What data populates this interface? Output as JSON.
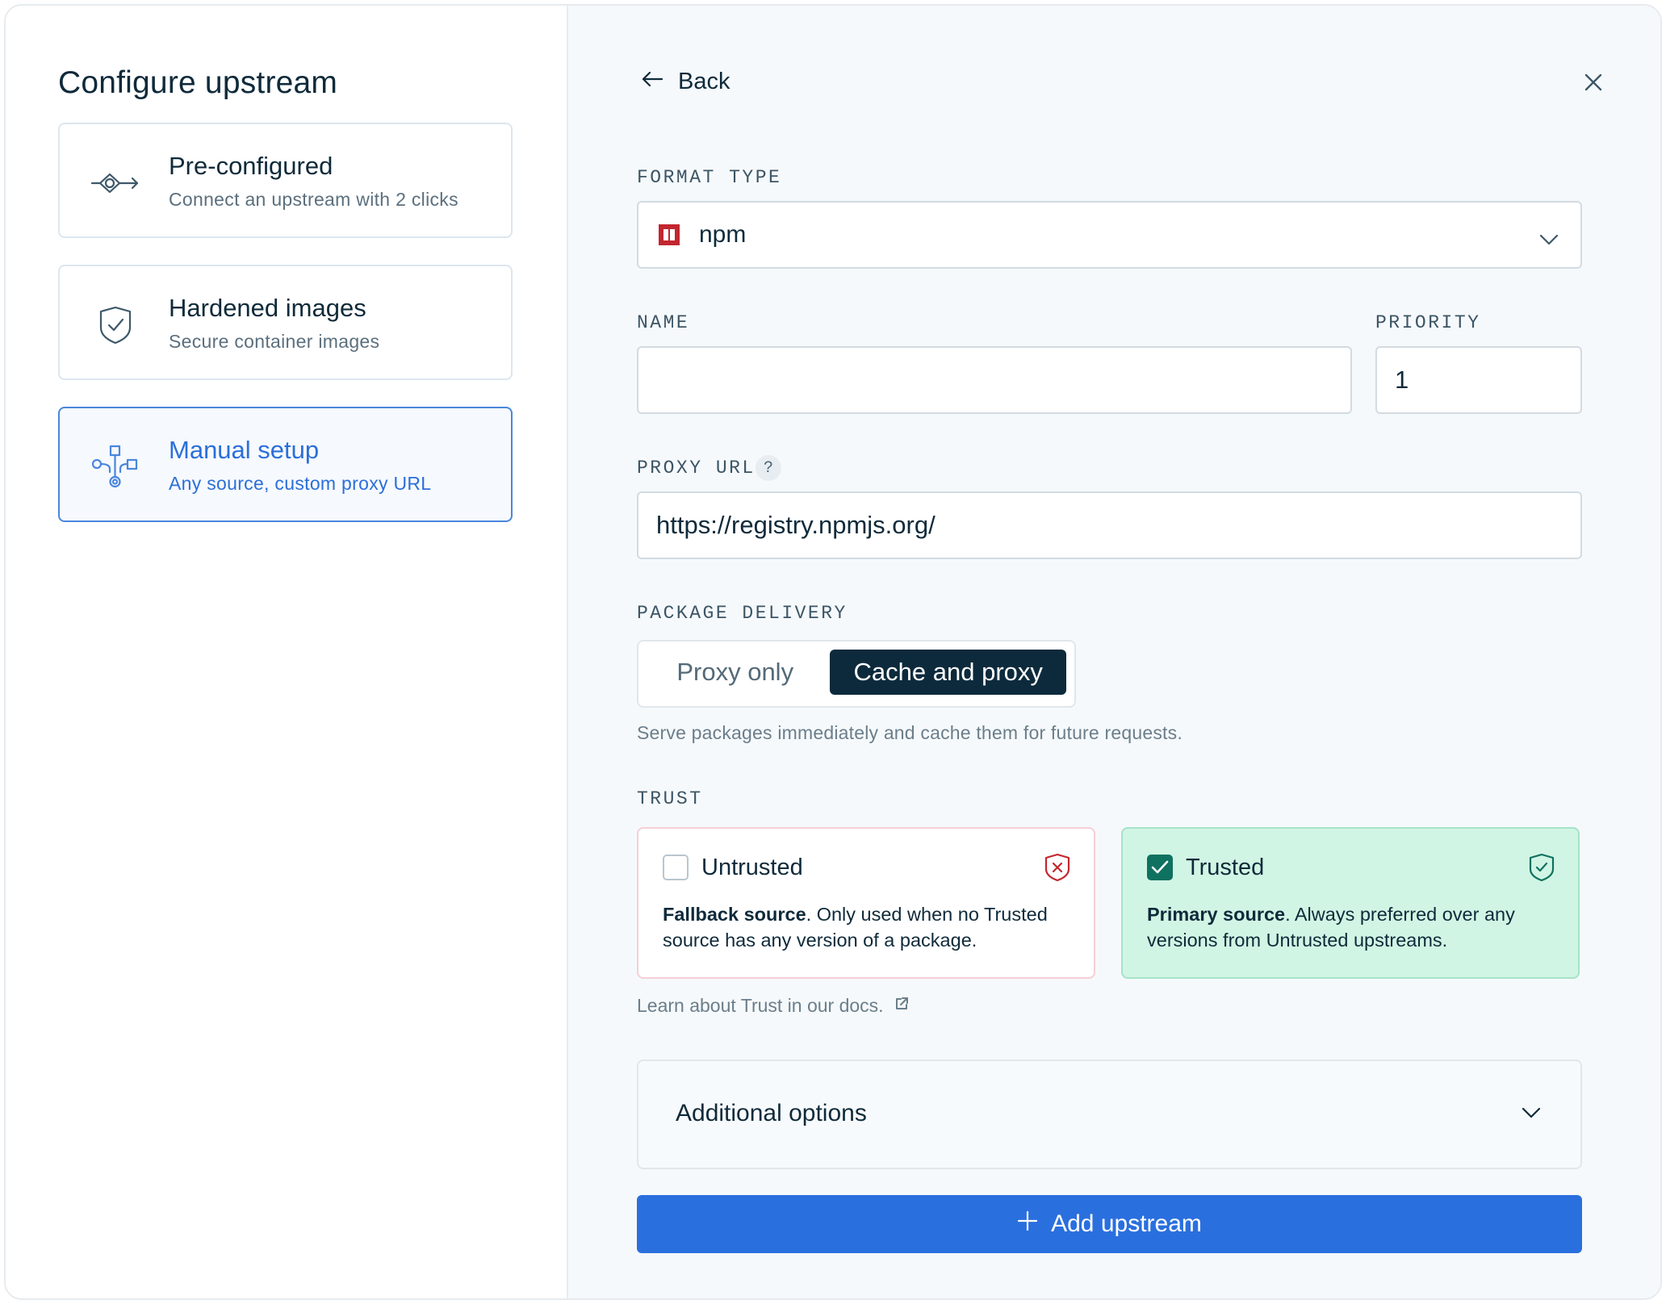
{
  "left": {
    "title": "Configure upstream",
    "cards": [
      {
        "title": "Pre-configured",
        "subtitle": "Connect an upstream with 2 clicks",
        "icon": "connector-icon",
        "selected": false
      },
      {
        "title": "Hardened images",
        "subtitle": "Secure container images",
        "icon": "shield-check-icon",
        "selected": false
      },
      {
        "title": "Manual setup",
        "subtitle": "Any source, custom proxy URL",
        "icon": "network-tree-icon",
        "selected": true
      }
    ]
  },
  "header": {
    "back_label": "Back",
    "close_icon": "close-icon"
  },
  "form": {
    "format_type_label": "FORMAT TYPE",
    "format_type_value": "npm",
    "name_label": "NAME",
    "name_value": "",
    "priority_label": "PRIORITY",
    "priority_value": "1",
    "proxy_url_label": "PROXY URL",
    "proxy_url_help": "?",
    "proxy_url_value": "https://registry.npmjs.org/",
    "package_delivery_label": "PACKAGE DELIVERY",
    "delivery_options": [
      "Proxy only",
      "Cache and proxy"
    ],
    "delivery_selected": "Cache and proxy",
    "delivery_hint": "Serve packages immediately and cache them for future requests.",
    "trust_label": "TRUST",
    "trust_options": [
      {
        "title": "Untrusted",
        "desc_bold": "Fallback source",
        "desc": ". Only used when no Trusted source has any version of a package.",
        "checked": false
      },
      {
        "title": "Trusted",
        "desc_bold": "Primary source",
        "desc": ". Always preferred over any versions from Untrusted upstreams.",
        "checked": true
      }
    ],
    "learn_link": "Learn about Trust in our docs.",
    "additional_options_label": "Additional options",
    "submit_label": "Add upstream"
  },
  "colors": {
    "accent": "#2a6fde",
    "dark": "#0d2a3c",
    "trusted_bg": "#d1f5e4",
    "untrusted_border": "#f5cfd6",
    "npm_red": "#c3262f"
  }
}
